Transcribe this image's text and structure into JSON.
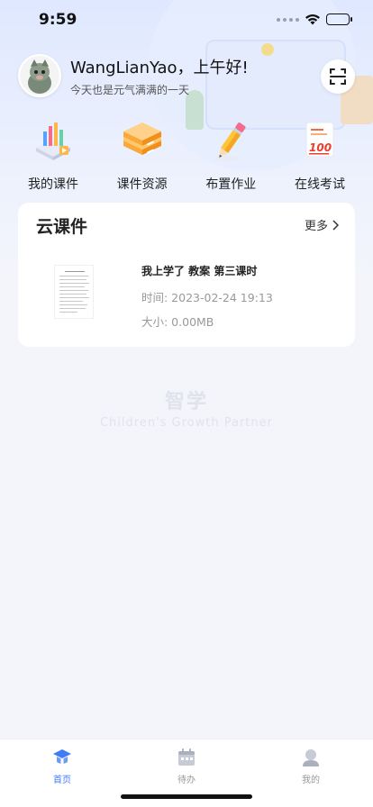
{
  "status_bar": {
    "time": "9:59"
  },
  "profile": {
    "greeting": "WangLianYao，上午好!",
    "subtitle": "今天也是元气满满的一天"
  },
  "quick_actions": [
    {
      "label": "我的课件",
      "icon": "courseware-chart-icon"
    },
    {
      "label": "课件资源",
      "icon": "resource-server-icon"
    },
    {
      "label": "布置作业",
      "icon": "pencil-icon"
    },
    {
      "label": "在线考试",
      "icon": "exam-paper-100-icon"
    }
  ],
  "cloud_card": {
    "title": "云课件",
    "more_label": "更多",
    "items": [
      {
        "name": "我上学了 教案 第三课时",
        "time": "时间: 2023-02-24 19:13",
        "size": "大小: 0.00MB"
      }
    ]
  },
  "watermark": {
    "title": "智学",
    "subtitle": "Children's Growth Partner"
  },
  "tab_bar": {
    "tabs": [
      {
        "label": "首页",
        "active": true
      },
      {
        "label": "待办",
        "active": false
      },
      {
        "label": "我的",
        "active": false
      }
    ]
  },
  "colors": {
    "accent": "#3f7cf6",
    "background": "#f3f5fb",
    "header_gradient_top": "#dfe8ff",
    "secondary_text": "#999999"
  }
}
